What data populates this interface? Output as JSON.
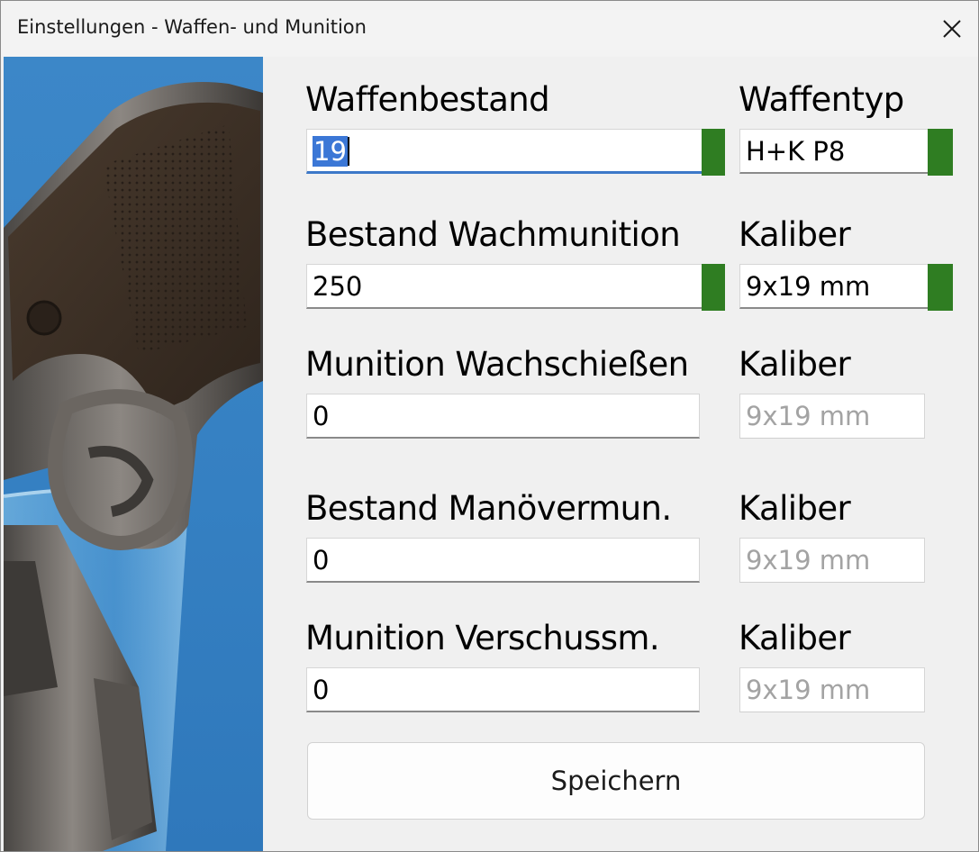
{
  "window": {
    "title": "Einstellungen - Waffen- und Munition"
  },
  "form": {
    "rows": [
      {
        "left_label": "Waffenbestand",
        "left_value": "19",
        "right_label": "Waffentyp",
        "right_value": "H+K P8"
      },
      {
        "left_label": "Bestand Wachmunition",
        "left_value": "250",
        "right_label": "Kaliber",
        "right_value": "9x19 mm"
      },
      {
        "left_label": "Munition Wachschießen",
        "left_value": "0",
        "right_label": "Kaliber",
        "right_value": "9x19 mm"
      },
      {
        "left_label": "Bestand Manövermun.",
        "left_value": "0",
        "right_label": "Kaliber",
        "right_value": "9x19 mm"
      },
      {
        "left_label": "Munition Verschussm.",
        "left_value": "0",
        "right_label": "Kaliber",
        "right_value": "9x19 mm"
      }
    ],
    "save_label": "Speichern"
  },
  "colors": {
    "status_ok": "#2f7d22",
    "selection": "#3b77d6",
    "artwork_background": "#3580c2"
  }
}
